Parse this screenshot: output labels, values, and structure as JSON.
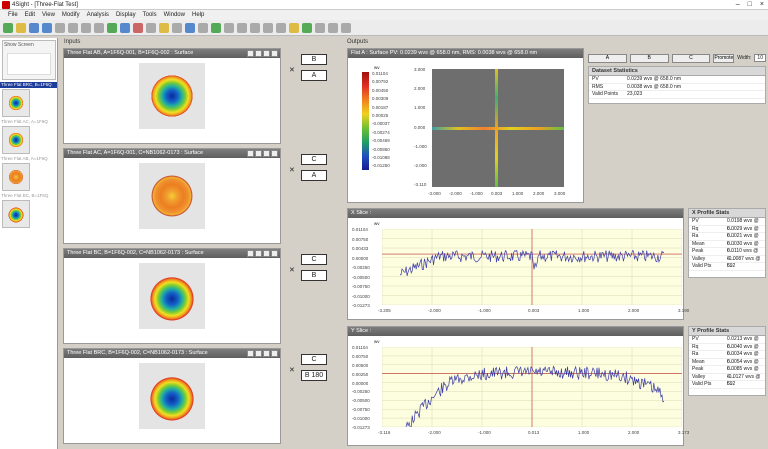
{
  "window": {
    "title": "4Sight - [Three-Flat Test]"
  },
  "menu": [
    "File",
    "Edit",
    "View",
    "Modify",
    "Analysis",
    "Display",
    "Tools",
    "Window",
    "Help"
  ],
  "left_panel": {
    "header": "Show Screen",
    "items": [
      {
        "label": "Three Flat BRC, B=1F6Q",
        "selected": true,
        "surface": "B"
      },
      {
        "label": "Three Flat AC, A=1F6Q",
        "selected": false,
        "surface": "A"
      },
      {
        "label": "Three Flat AB, A=1F6Q",
        "selected": false,
        "surface": "A"
      },
      {
        "label": "Three Flat BC, B=1F6Q",
        "selected": false,
        "surface": "B"
      }
    ]
  },
  "inputs": {
    "label": "Inputs",
    "panels": [
      {
        "title": "Three Flat AB, A=1F6Q-001, B=1F6Q-002 : Surface",
        "top": "B",
        "bottom": "A",
        "disc": "dA"
      },
      {
        "title": "Three Flat AC, A=1F6Q-001, C=NB1062-0173 : Surface",
        "top": "C",
        "bottom": "A",
        "disc": "dB"
      },
      {
        "title": "Three Flat BC, B=1F6Q-002, C=NB1062-0173 : Surface",
        "top": "C",
        "bottom": "B",
        "disc": "dC"
      },
      {
        "title": "Three Flat BRC, B=1F6Q-002, C=NB1062-0173 : Surface",
        "top": "C",
        "bottom": "B 180",
        "disc": "dC"
      }
    ]
  },
  "outputs": {
    "label": "Outputs",
    "flat_panel": {
      "title": "Flat A : Surface   PV: 0.0239 wvs @ 658.0 nm, RMS: 0.0038 wvs @ 658.0 nm",
      "colorbar_unit": "wv",
      "colorbar_ticks": [
        "0.01104",
        "0.00792",
        "0.00450",
        "0.00309",
        "0.00187",
        "0.00025",
        "-0.00037",
        "-0.00274",
        "-0.00469",
        "-0.00860",
        "-0.01088",
        "-0.01250"
      ],
      "y_ticks": [
        "3.000",
        "2.000",
        "1.000",
        "0.000",
        "-1.000",
        "-2.000",
        "-3.110"
      ],
      "x_ticks": [
        "-3.000",
        "-2.000",
        "-1.000",
        "0.003",
        "1.000",
        "2.000",
        "3.000"
      ]
    },
    "buttons": {
      "a": "A",
      "b": "B",
      "c": "C",
      "promote": "Promote",
      "width_label": "Width:",
      "width_value": "10"
    },
    "dataset_stats": {
      "title": "Dataset Statistics",
      "rows": [
        {
          "k": "PV",
          "v": "0.0239 wvs @ 658.0 nm"
        },
        {
          "k": "RMS",
          "v": "0.0038 wvs @ 658.0 nm"
        },
        {
          "k": "Valid Points",
          "v": "23,023"
        }
      ]
    },
    "x_slice": {
      "title": "X Slice :",
      "y_unit": "wv",
      "y_ticks": [
        "0.01104",
        "0.00750",
        "0.00433",
        "0.00000",
        "-0.00250",
        "-0.00500",
        "-0.00750",
        "-0.01000",
        "-0.01273"
      ],
      "x_ticks": [
        "-3.205",
        "-2.000",
        "-1.000",
        "0.003",
        "1.000",
        "2.000",
        "3.190"
      ],
      "stats_title": "X Profile Stats",
      "stats": [
        {
          "k": "PV",
          "v": "0.0198 wvs @ 6..."
        },
        {
          "k": "Rq",
          "v": "0.0029 wvs @ 6..."
        },
        {
          "k": "Ra",
          "v": "0.0021 wvs @ 6..."
        },
        {
          "k": "Mean",
          "v": "0.0030 wvs @ 6..."
        },
        {
          "k": "Peak",
          "v": "0.0110 wvs @ 6..."
        },
        {
          "k": "Valley",
          "v": "-0.0087 wvs @ 6..."
        },
        {
          "k": "Valid Pts",
          "v": "592"
        }
      ]
    },
    "y_slice": {
      "title": "Y Slice :",
      "y_unit": "wv",
      "y_ticks": [
        "0.01104",
        "0.00750",
        "0.00500",
        "0.00250",
        "0.00000",
        "-0.00250",
        "-0.00500",
        "-0.00750",
        "-0.01000",
        "-0.01273"
      ],
      "x_ticks": [
        "-3.116",
        "-2.000",
        "-1.000",
        "0.013",
        "1.000",
        "2.000",
        "3.173"
      ],
      "stats_title": "Y Profile Stats",
      "stats": [
        {
          "k": "PV",
          "v": "0.0213 wvs @ 6..."
        },
        {
          "k": "Rq",
          "v": "0.0040 wvs @ 6..."
        },
        {
          "k": "Ra",
          "v": "0.0034 wvs @ 6..."
        },
        {
          "k": "Mean",
          "v": "0.0054 wvs @ 6..."
        },
        {
          "k": "Peak",
          "v": "0.0085 wvs @ 6..."
        },
        {
          "k": "Valley",
          "v": "-0.0127 wvs @ 6..."
        },
        {
          "k": "Valid Pts",
          "v": "592"
        }
      ]
    }
  },
  "colors": {
    "accent": "#1e3c9a",
    "profile_line": "#3a3aa8",
    "cursor": "#c03030"
  }
}
